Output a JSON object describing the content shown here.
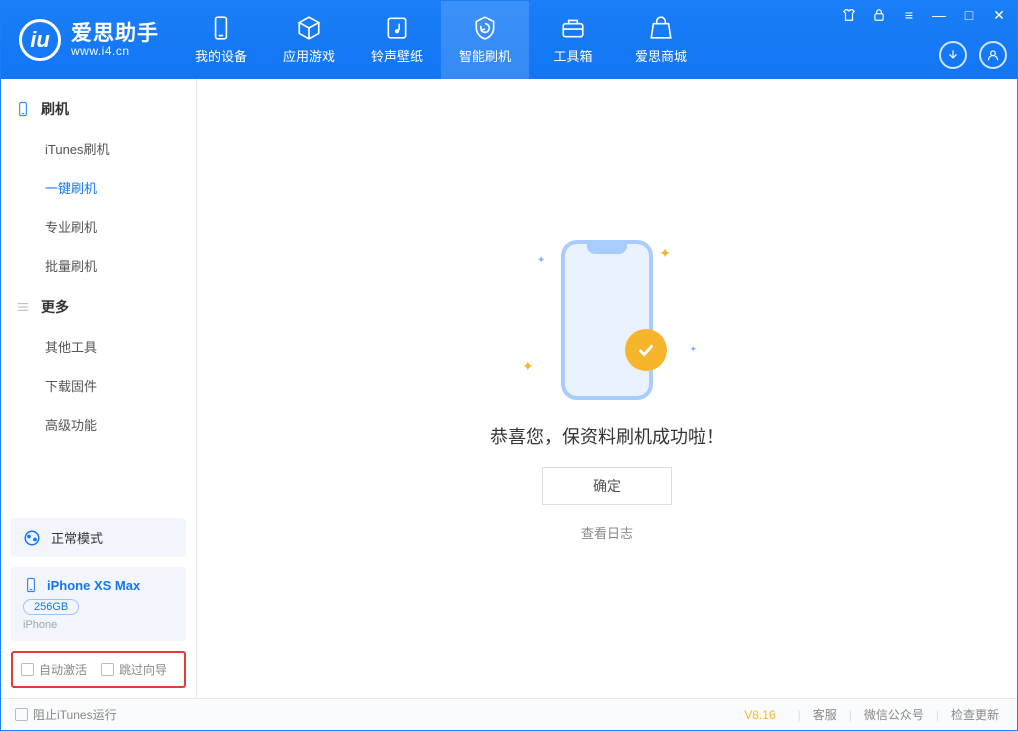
{
  "app": {
    "title": "爱思助手",
    "subtitle": "www.i4.cn"
  },
  "tabs": [
    {
      "id": "device",
      "label": "我的设备"
    },
    {
      "id": "apps",
      "label": "应用游戏"
    },
    {
      "id": "media",
      "label": "铃声壁纸"
    },
    {
      "id": "flash",
      "label": "智能刷机",
      "active": true
    },
    {
      "id": "toolbox",
      "label": "工具箱"
    },
    {
      "id": "store",
      "label": "爱思商城"
    }
  ],
  "sidebar": {
    "sections": [
      {
        "title": "刷机",
        "items": [
          {
            "id": "itunes-flash",
            "label": "iTunes刷机"
          },
          {
            "id": "one-click",
            "label": "一键刷机",
            "active": true
          },
          {
            "id": "pro-flash",
            "label": "专业刷机"
          },
          {
            "id": "batch-flash",
            "label": "批量刷机"
          }
        ]
      },
      {
        "title": "更多",
        "items": [
          {
            "id": "other-tools",
            "label": "其他工具"
          },
          {
            "id": "download-fw",
            "label": "下载固件"
          },
          {
            "id": "advanced",
            "label": "高级功能"
          }
        ]
      }
    ],
    "status": {
      "label": "正常模式"
    },
    "device": {
      "name": "iPhone XS Max",
      "storage": "256GB",
      "type": "iPhone"
    },
    "options": {
      "auto_activate": "自动激活",
      "skip_guide": "跳过向导"
    }
  },
  "main": {
    "success_text": "恭喜您，保资料刷机成功啦！",
    "confirm_label": "确定",
    "view_log_label": "查看日志"
  },
  "footer": {
    "block_itunes": "阻止iTunes运行",
    "version": "V8.16",
    "links": {
      "support": "客服",
      "wechat": "微信公众号",
      "update": "检查更新"
    }
  }
}
